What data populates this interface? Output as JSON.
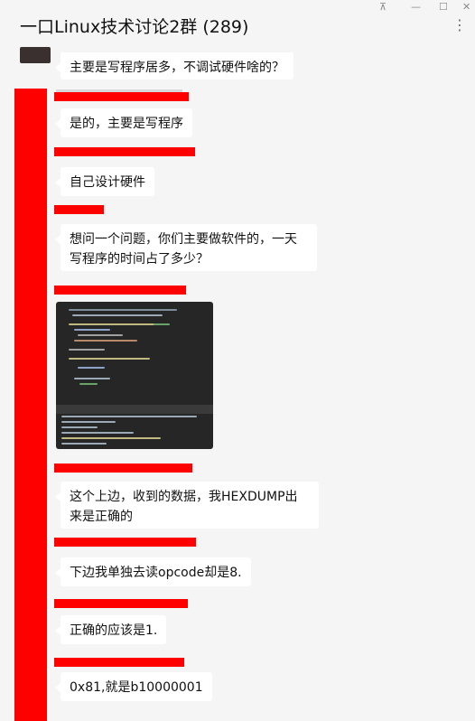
{
  "window": {
    "title": "一口Linux技术讨论2群 (289)",
    "controls": {
      "pin": "⊼",
      "minimize": "—",
      "maximize": "☐",
      "close": "✕"
    },
    "more": "⋮"
  },
  "messages": [
    {
      "text": "主要是写程序居多，不调试硬件啥的？"
    },
    {
      "text": "是的，主要是写程序"
    },
    {
      "text": "自己设计硬件"
    },
    {
      "text": "想问一个问题，你们主要做软件的，一天写程序的时间占了多少？"
    },
    {
      "type": "image",
      "description_icon": "code-screenshot-thumbnail"
    },
    {
      "text": "这个上边，收到的数据，我HEXDUMP出来是正确的"
    },
    {
      "text": "下边我单独去读opcode却是8."
    },
    {
      "text": "正确的应该是1."
    },
    {
      "text": "0x81,就是b10000001"
    }
  ],
  "colors": {
    "background": "#f5f5f5",
    "bubble": "#ffffff",
    "redaction": "#ff0000"
  }
}
